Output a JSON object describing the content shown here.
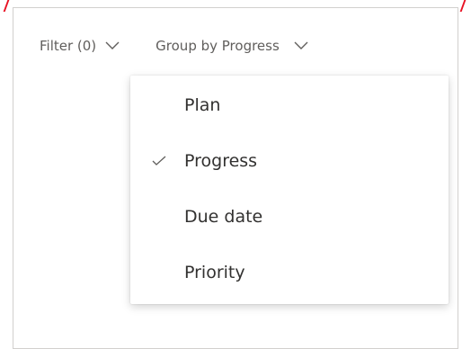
{
  "toolbar": {
    "filter_label": "Filter (0)",
    "group_by_label": "Group by Progress"
  },
  "group_menu": {
    "items": [
      {
        "label": "Plan",
        "checked": false
      },
      {
        "label": "Progress",
        "checked": true
      },
      {
        "label": "Due date",
        "checked": false
      },
      {
        "label": "Priority",
        "checked": false
      }
    ]
  },
  "colors": {
    "accent_mark": "#e81123",
    "text_primary": "#323130",
    "text_secondary": "#605e5c",
    "border": "#d2d0ce"
  }
}
